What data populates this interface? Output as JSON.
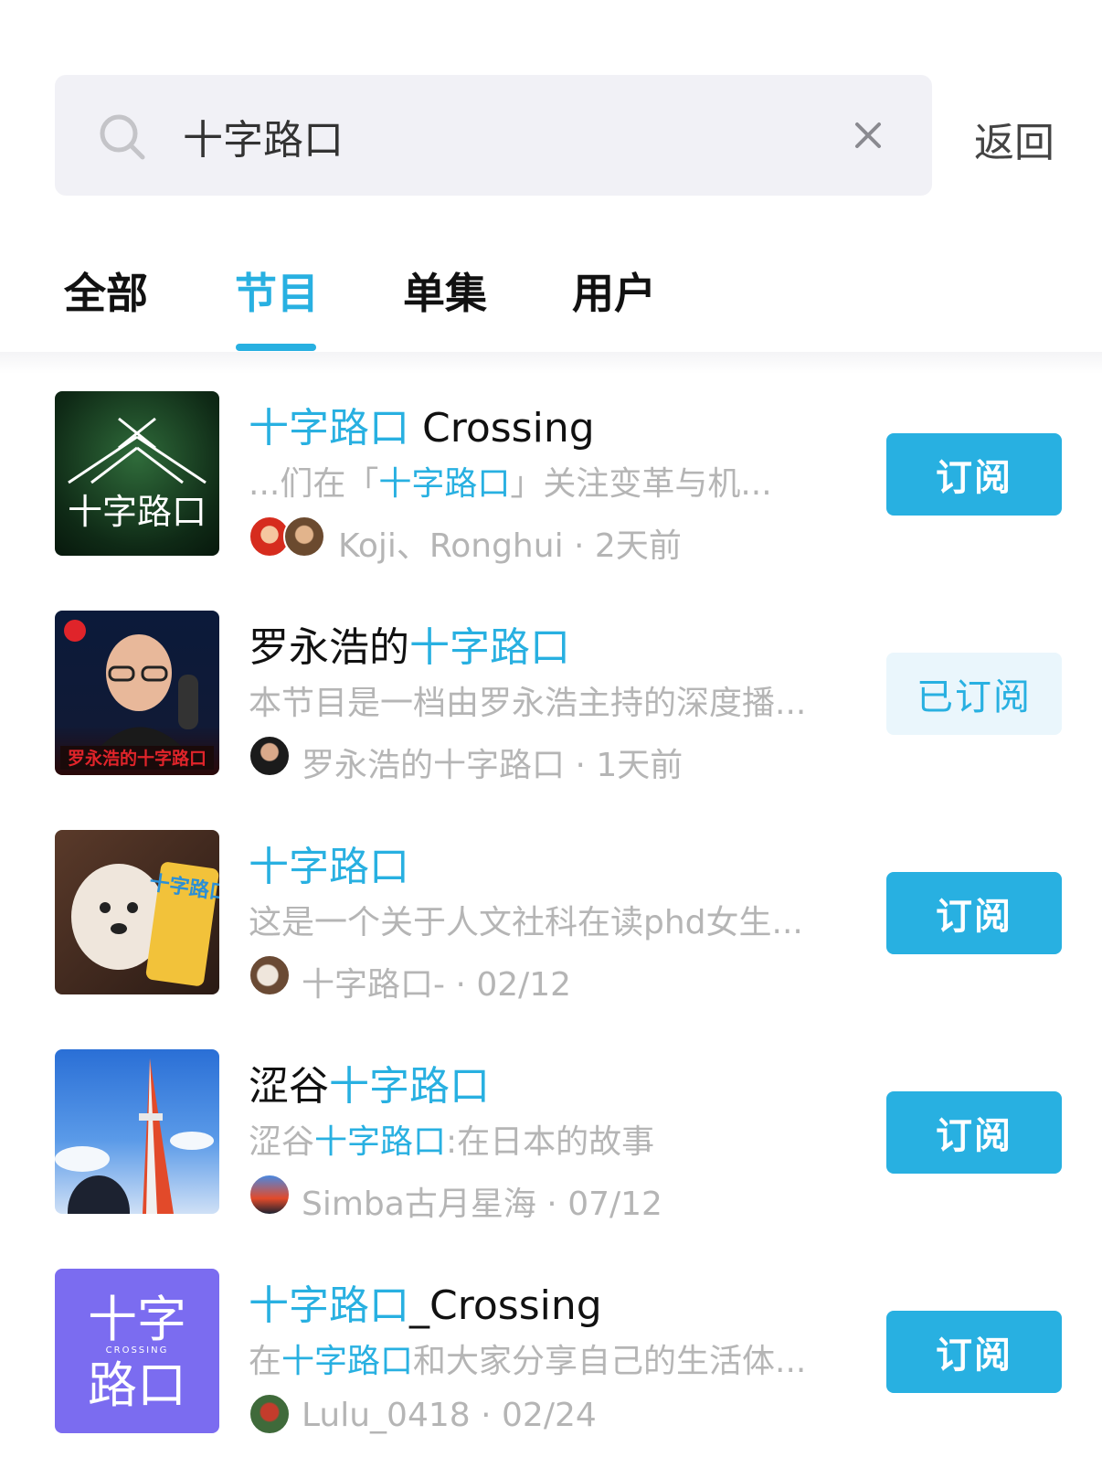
{
  "search": {
    "query": "十字路口",
    "back_label": "返回"
  },
  "tabs": [
    {
      "label": "全部",
      "active": false
    },
    {
      "label": "节目",
      "active": true
    },
    {
      "label": "单集",
      "active": false
    },
    {
      "label": "用户",
      "active": false
    }
  ],
  "results": [
    {
      "title_hl": "十字路口",
      "title_rest": " Crossing",
      "desc_pre": "...们在「",
      "desc_hl": "十字路口",
      "desc_post": "」关注变革与机...",
      "authors": "Koji、Ronghui",
      "time": "2天前",
      "button": "订阅",
      "subscribed": false,
      "cover_text": "十字路口"
    },
    {
      "title_pre": "罗永浩的",
      "title_hl": "十字路口",
      "desc_pre": "本节目是一档由罗永浩主持的深度播...",
      "authors": "罗永浩的十字路口",
      "time": "1天前",
      "button": "已订阅",
      "subscribed": true,
      "cover_text": "罗永浩的十字路口"
    },
    {
      "title_hl": "十字路口",
      "desc_pre": "这是一个关于人文社科在读phd女生...",
      "authors": "十字路口-",
      "time": "02/12",
      "button": "订阅",
      "subscribed": false,
      "cover_text": "十字路口"
    },
    {
      "title_pre": "涩谷",
      "title_hl": "十字路口",
      "desc_pre": "涩谷",
      "desc_hl": "十字路口",
      "desc_post": ":在日本的故事",
      "authors": "Simba古月星海",
      "time": "07/12",
      "button": "订阅",
      "subscribed": false
    },
    {
      "title_hl": "十字路口",
      "title_rest": "_Crossing",
      "desc_pre": "在",
      "desc_hl": "十字路口",
      "desc_post": "和大家分享自己的生活体...",
      "authors": "Lulu_0418",
      "time": "02/24",
      "button": "订阅",
      "subscribed": false,
      "cover_text_top": "十字",
      "cover_text_small": "CROSSING",
      "cover_text_bottom": "路口"
    }
  ],
  "colors": {
    "accent": "#28b0e1",
    "subscribed_bg": "#eaf6fc",
    "search_bg": "#f1f1f6"
  }
}
